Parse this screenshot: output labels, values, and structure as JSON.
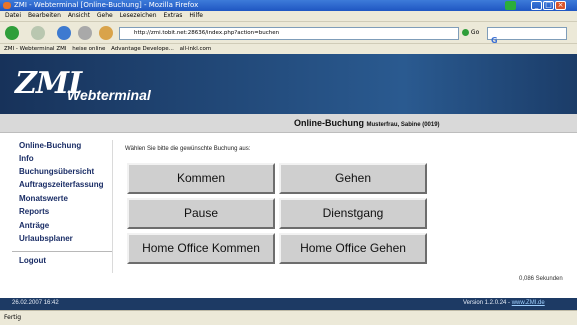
{
  "window": {
    "title": "ZMI - Webterminal [Online-Buchung] - Mozilla Firefox"
  },
  "menubar": [
    "Datei",
    "Bearbeiten",
    "Ansicht",
    "Gehe",
    "Lesezeichen",
    "Extras",
    "Hilfe"
  ],
  "navbar": {
    "url": "http://zmi.tobit.net:28636/index.php?action=buchen",
    "go_label": "Go",
    "search_letter": "G"
  },
  "bookmarks": [
    "ZMI - Webterminal ZMI",
    "heise online",
    "Advantage Develope...",
    "all-inkl.com"
  ],
  "header": {
    "logo": "ZMI",
    "subtitle": "Webterminal"
  },
  "page": {
    "title": "Online-Buchung",
    "user": "Musterfrau, Sabine (0019)"
  },
  "sidebar": {
    "items": [
      {
        "label": "Online-Buchung"
      },
      {
        "label": "Info"
      },
      {
        "label": "Buchungsübersicht"
      },
      {
        "label": "Auftragszeiterfassung"
      },
      {
        "label": "Monatswerte"
      },
      {
        "label": "Reports"
      },
      {
        "label": "Anträge"
      },
      {
        "label": "Urlaubsplaner"
      }
    ],
    "logout": "Logout"
  },
  "main": {
    "instruction": "Wählen Sie bitte die gewünschte Buchung aus:",
    "buttons": [
      {
        "label": "Kommen"
      },
      {
        "label": "Gehen"
      },
      {
        "label": "Pause"
      },
      {
        "label": "Dienstgang"
      },
      {
        "label": "Home Office Kommen"
      },
      {
        "label": "Home Office Gehen"
      }
    ],
    "timing": "0,086 Sekunden"
  },
  "footer": {
    "datetime": "26.02.2007 16:42",
    "version": "Version 1.2.0.24 -",
    "link": "www.ZMI.de"
  },
  "status": "Fertig",
  "colors": {
    "header_blue": "#17325a",
    "footer_blue": "#1d3a64",
    "nav_text": "#1a2d66",
    "button_gray": "#cfcfcf"
  }
}
